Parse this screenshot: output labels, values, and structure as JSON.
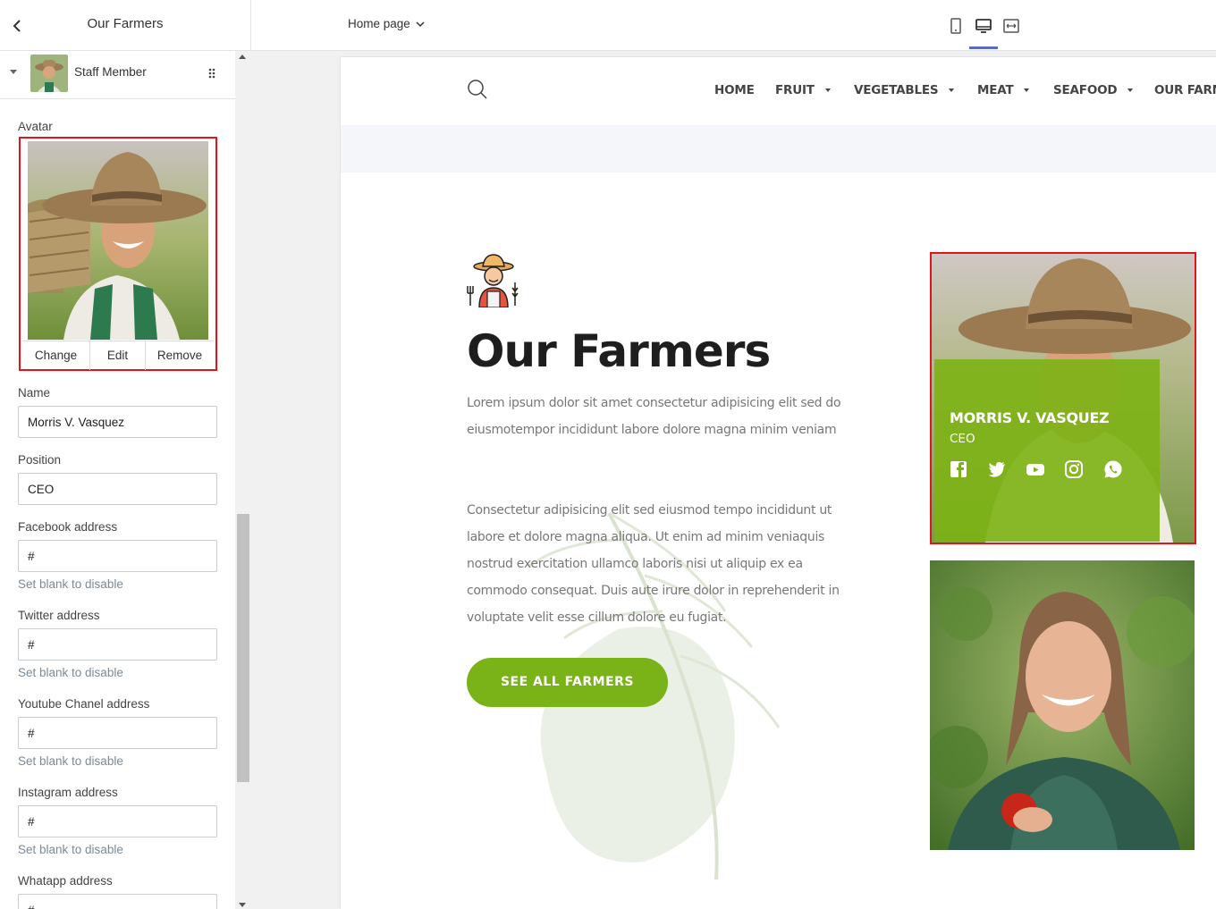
{
  "sidebar": {
    "title": "Our Farmers",
    "block_label": "Staff Member",
    "avatar": {
      "label": "Avatar",
      "change": "Change",
      "edit": "Edit",
      "remove": "Remove"
    },
    "fields": {
      "name": {
        "label": "Name",
        "value": "Morris V. Vasquez"
      },
      "position": {
        "label": "Position",
        "value": "CEO"
      },
      "facebook": {
        "label": "Facebook address",
        "value": "#",
        "hint": "Set blank to disable"
      },
      "twitter": {
        "label": "Twitter address",
        "value": "#",
        "hint": "Set blank to disable"
      },
      "youtube": {
        "label": "Youtube Chanel address",
        "value": "#",
        "hint": "Set blank to disable"
      },
      "instagram": {
        "label": "Instagram address",
        "value": "#",
        "hint": "Set blank to disable"
      },
      "whatsapp": {
        "label": "Whatapp address",
        "value": "#"
      }
    }
  },
  "topbar": {
    "page_select": "Home page",
    "devices": [
      "mobile-icon",
      "desktop-icon",
      "fullwidth-icon"
    ],
    "active_device": "desktop-icon"
  },
  "preview": {
    "nav": {
      "home": "HOME",
      "fruit": "FRUIT",
      "vegetables": "VEGETABLES",
      "meat": "MEAT",
      "seafood": "SEAFOOD",
      "our_farm": "OUR FARM"
    },
    "section": {
      "title": "Our Farmers",
      "para1_line1": "Lorem ipsum dolor sit amet consectetur adipisicing elit sed do",
      "para1_line2": "eiusmotempor incididunt labore dolore magna minim veniam",
      "para2_line1": "Consectetur adipisicing elit sed eiusmod tempo incididunt ut",
      "para2_line2": "labore et dolore magna aliqua. Ut enim ad minim veniaquis",
      "para2_line3": "nostrud exercitation ullamco laboris nisi ut aliquip ex ea",
      "para2_line4": "commodo consequat. Duis aute irure dolor in reprehenderit in",
      "para2_line5": "voluptate velit esse cillum dolore eu fugiat.",
      "cta": "SEE ALL FARMERS"
    },
    "card": {
      "name": "MORRIS V. VASQUEZ",
      "position": "CEO",
      "social_icons": [
        "facebook-icon",
        "twitter-icon",
        "youtube-icon",
        "instagram-icon",
        "whatsapp-icon"
      ]
    }
  },
  "colors": {
    "accent_green": "#7ab317",
    "selection_red": "#e0141c",
    "device_active": "#5c6ac4"
  }
}
